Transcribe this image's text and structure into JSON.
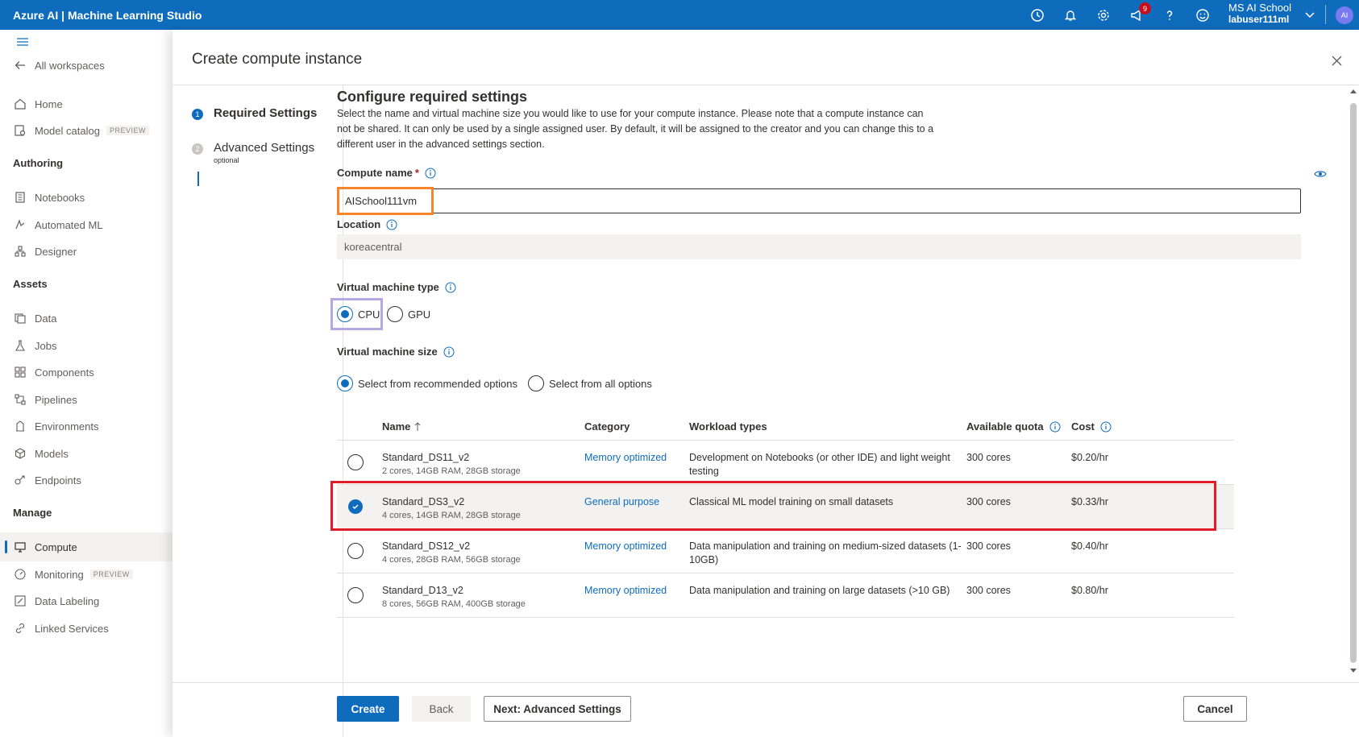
{
  "topbar": {
    "title": "Azure AI | Machine Learning Studio",
    "notification_count": "9",
    "account_name": "MS AI School",
    "account_user": "labuser111ml",
    "avatar_initials": "AI"
  },
  "sidebar": {
    "back_label": "All workspaces",
    "home": "Home",
    "model_catalog": "Model catalog",
    "preview_tag": "PREVIEW",
    "section_authoring": "Authoring",
    "notebooks": "Notebooks",
    "automated_ml": "Automated ML",
    "designer": "Designer",
    "section_assets": "Assets",
    "data": "Data",
    "jobs": "Jobs",
    "components": "Components",
    "pipelines": "Pipelines",
    "environments": "Environments",
    "models": "Models",
    "endpoints": "Endpoints",
    "section_manage": "Manage",
    "compute": "Compute",
    "monitoring": "Monitoring",
    "data_labeling": "Data Labeling",
    "linked_services": "Linked Services"
  },
  "panel": {
    "title": "Create compute instance"
  },
  "steps": [
    {
      "number": "1",
      "label": "Required Settings",
      "sub": ""
    },
    {
      "number": "2",
      "label": "Advanced Settings",
      "sub": "optional"
    }
  ],
  "form": {
    "heading": "Configure required settings",
    "description": "Select the name and virtual machine size you would like to use for your compute instance. Please note that a compute instance can not be shared. It can only be used by a single assigned user. By default, it will be assigned to the creator and you can change this to a different user in the advanced settings section.",
    "compute_name_label": "Compute name",
    "required_mark": "*",
    "compute_name_value": "AISchool111vm",
    "location_label": "Location",
    "location_value": "koreacentral",
    "vm_type_label": "Virtual machine type",
    "vm_type_cpu": "CPU",
    "vm_type_gpu": "GPU",
    "vm_size_label": "Virtual machine size",
    "vm_size_recommended": "Select from recommended options",
    "vm_size_all": "Select from all options"
  },
  "table": {
    "headers": {
      "name": "Name",
      "category": "Category",
      "workload": "Workload types",
      "quota": "Available quota",
      "cost": "Cost"
    },
    "rows": [
      {
        "name": "Standard_DS11_v2",
        "specs": "2 cores, 14GB RAM, 28GB storage",
        "category": "Memory optimized",
        "workload": "Development on Notebooks (or other IDE) and light weight testing",
        "quota": "300 cores",
        "cost": "$0.20/hr"
      },
      {
        "name": "Standard_DS3_v2",
        "specs": "4 cores, 14GB RAM, 28GB storage",
        "category": "General purpose",
        "workload": "Classical ML model training on small datasets",
        "quota": "300 cores",
        "cost": "$0.33/hr"
      },
      {
        "name": "Standard_DS12_v2",
        "specs": "4 cores, 28GB RAM, 56GB storage",
        "category": "Memory optimized",
        "workload": "Data manipulation and training on medium-sized datasets (1-10GB)",
        "quota": "300 cores",
        "cost": "$0.40/hr"
      },
      {
        "name": "Standard_D13_v2",
        "specs": "8 cores, 56GB RAM, 400GB storage",
        "category": "Memory optimized",
        "workload": "Data manipulation and training on large datasets (>10 GB)",
        "quota": "300 cores",
        "cost": "$0.80/hr"
      }
    ]
  },
  "footer": {
    "create": "Create",
    "back": "Back",
    "next": "Next: Advanced Settings",
    "cancel": "Cancel"
  },
  "colors": {
    "accent": "#0f6cbd",
    "highlight_orange": "#f7862b",
    "highlight_purple": "#b4a7e3",
    "highlight_red": "#e01e2a"
  }
}
